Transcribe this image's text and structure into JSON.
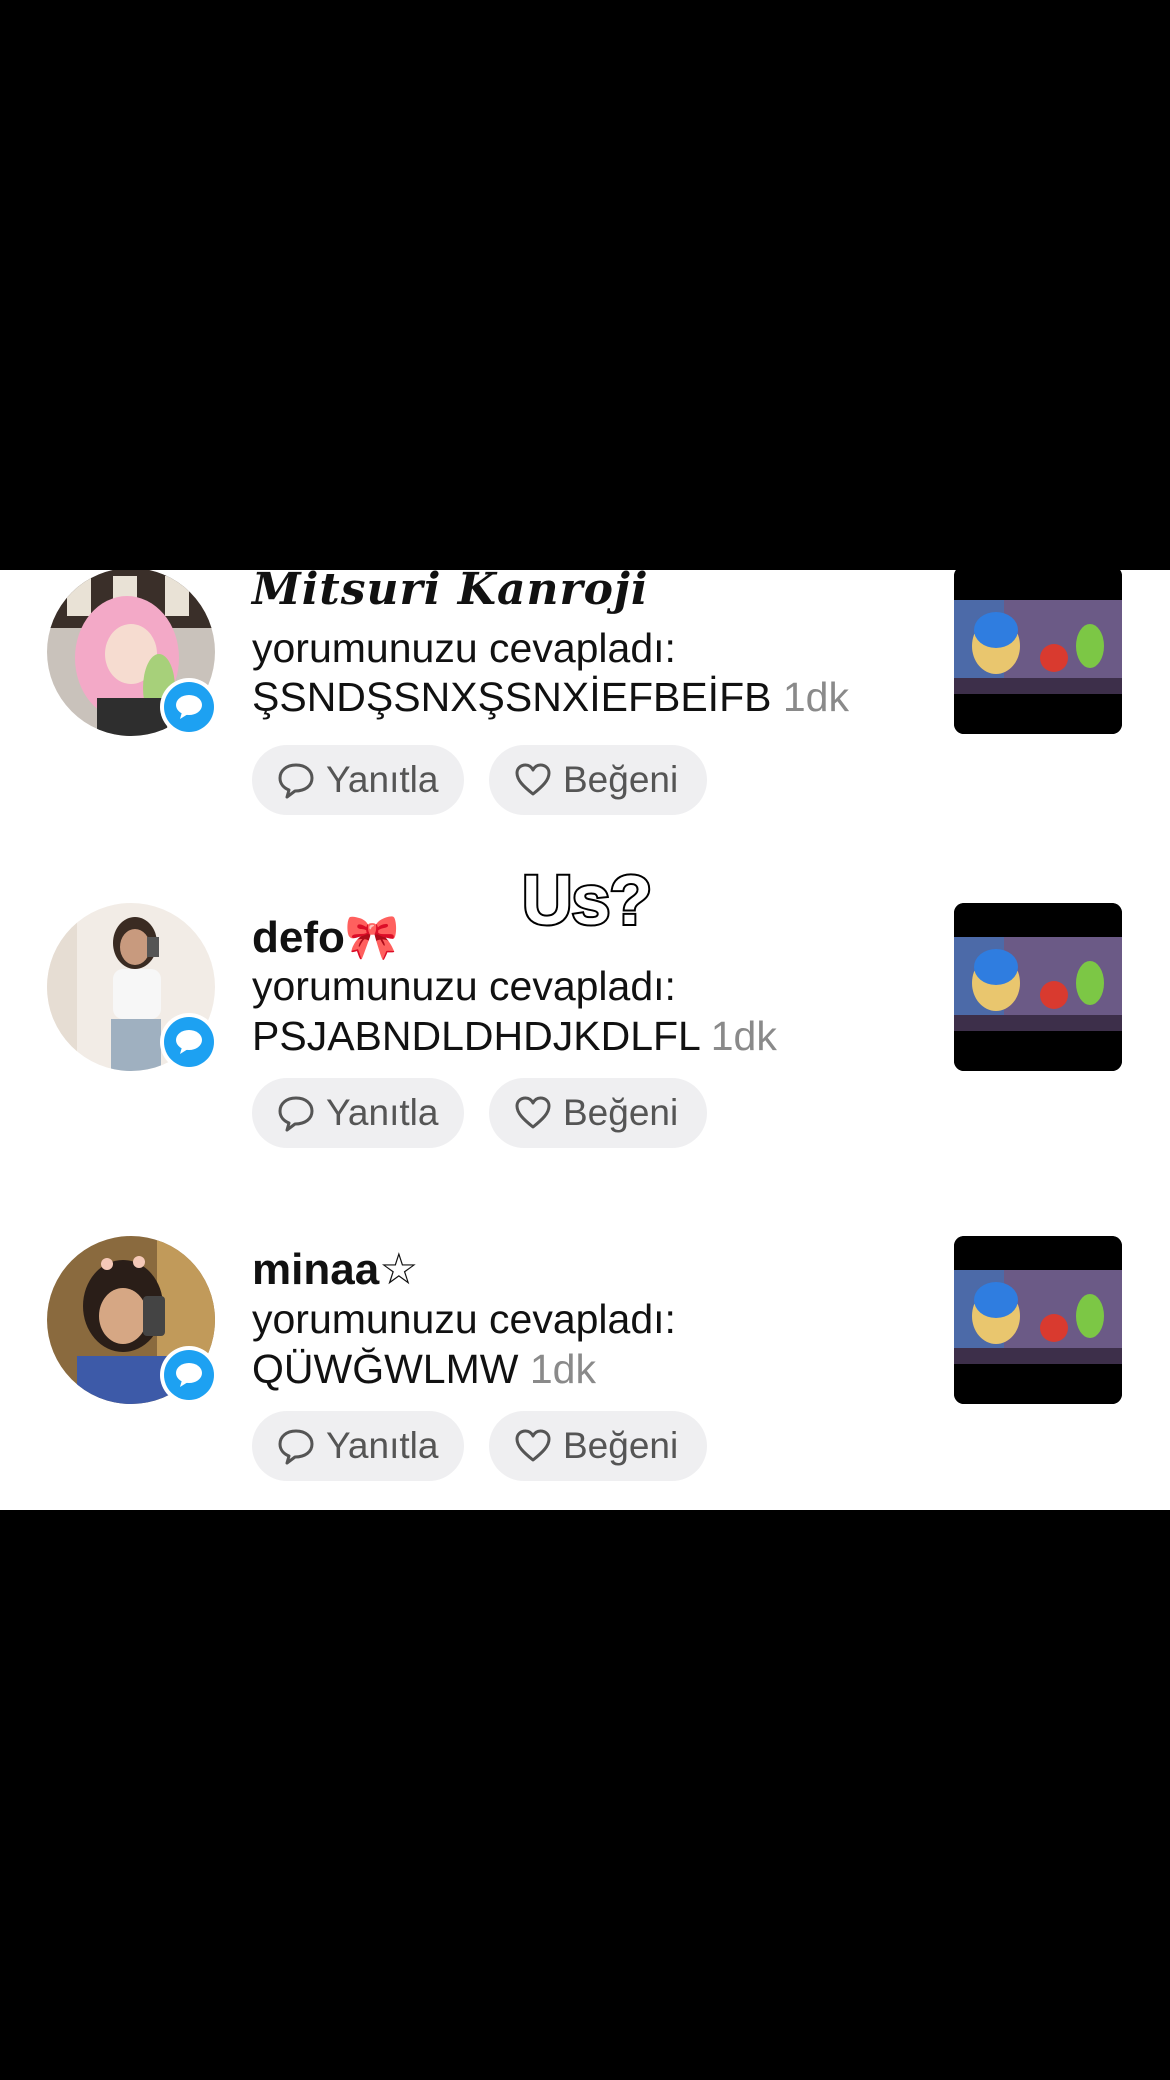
{
  "overlay_text": "Us?",
  "notifications": [
    {
      "name": "𝑴𝒊𝒕𝒔𝒖𝒓𝒊 𝑲𝒂𝒏𝒓𝒐𝒋𝒊",
      "action": "yorumunuzu cevapladı:",
      "comment": "ŞSNDŞSNXŞSNXİEFBEİFB",
      "time": "1dk",
      "reply_label": "Yanıtla",
      "like_label": "Beğeni"
    },
    {
      "name": "defo🎀",
      "action": "yorumunuzu cevapladı:",
      "comment": "PSJABNDLDHDJKDLFL",
      "time": "1dk",
      "reply_label": "Yanıtla",
      "like_label": "Beğeni"
    },
    {
      "name": "minaa☆",
      "action": "yorumunuzu cevapladı:",
      "comment": "QÜWĞWLMW",
      "time": "1dk",
      "reply_label": "Yanıtla",
      "like_label": "Beğeni"
    }
  ],
  "colors": {
    "badge": "#1da1f2",
    "button_bg": "#efeff1",
    "time": "#8a8a8a"
  }
}
